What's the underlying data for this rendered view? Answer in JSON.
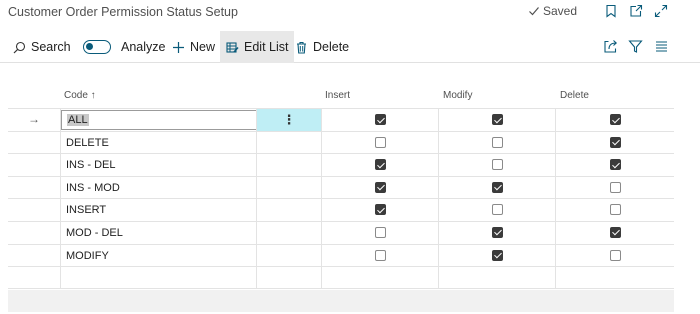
{
  "page": {
    "title": "Customer Order Permission Status Setup",
    "saved_label": "Saved"
  },
  "actions": {
    "search": "Search",
    "analyze": "Analyze",
    "new": "New",
    "edit_list": "Edit List",
    "delete": "Delete"
  },
  "table": {
    "columns": {
      "code": "Code ↑",
      "insert": "Insert",
      "modify": "Modify",
      "delete": "Delete"
    },
    "rows": [
      {
        "code": "ALL",
        "insert": true,
        "modify": true,
        "delete": true
      },
      {
        "code": "DELETE",
        "insert": false,
        "modify": false,
        "delete": true
      },
      {
        "code": "INS - DEL",
        "insert": true,
        "modify": false,
        "delete": true
      },
      {
        "code": "INS - MOD",
        "insert": true,
        "modify": true,
        "delete": false
      },
      {
        "code": "INSERT",
        "insert": true,
        "modify": false,
        "delete": false
      },
      {
        "code": "MOD - DEL",
        "insert": false,
        "modify": true,
        "delete": true
      },
      {
        "code": "MODIFY",
        "insert": false,
        "modify": true,
        "delete": false
      }
    ],
    "row_arrow": "→",
    "row_menu": "⋮"
  },
  "colors": {
    "accent": "#0a5b7a",
    "selected_cell": "#bfeef5"
  }
}
